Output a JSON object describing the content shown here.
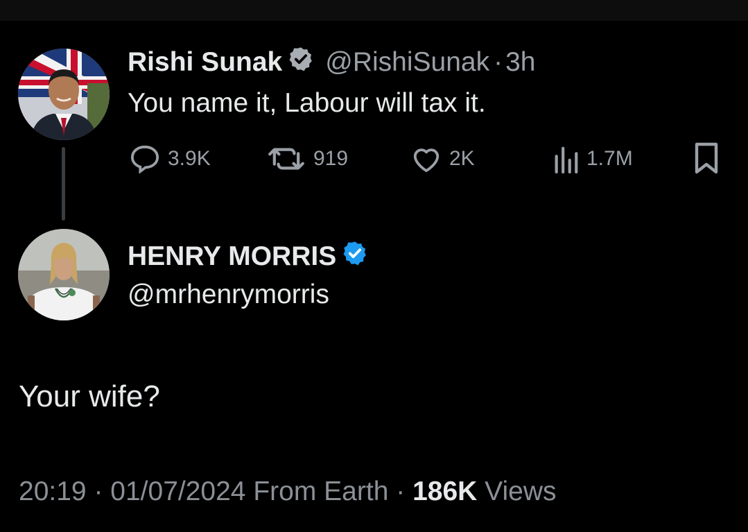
{
  "original": {
    "author_name": "Rishi Sunak",
    "handle": "@RishiSunak",
    "separator": "·",
    "time": "3h",
    "text": "You name it, Labour will tax it.",
    "stats": {
      "replies": "3.9K",
      "retweets": "919",
      "likes": "2K",
      "views": "1.7M"
    }
  },
  "reply": {
    "author_name": "HENRY MORRIS",
    "handle": "@mrhenrymorris",
    "text": "Your wife?",
    "time": "20:19",
    "sep1": "·",
    "date": "01/07/2024",
    "source": "From Earth",
    "sep2": "·",
    "views_count": "186K",
    "views_label": "Views"
  },
  "colors": {
    "background": "#000000",
    "text": "#e7e9ea",
    "muted": "#9aa0a6",
    "verified_blue": "#1d9bf0",
    "verified_gray": "#a8adb3"
  },
  "icons": [
    "reply-icon",
    "retweet-icon",
    "like-icon",
    "views-icon",
    "bookmark-icon",
    "verified-badge-icon"
  ]
}
